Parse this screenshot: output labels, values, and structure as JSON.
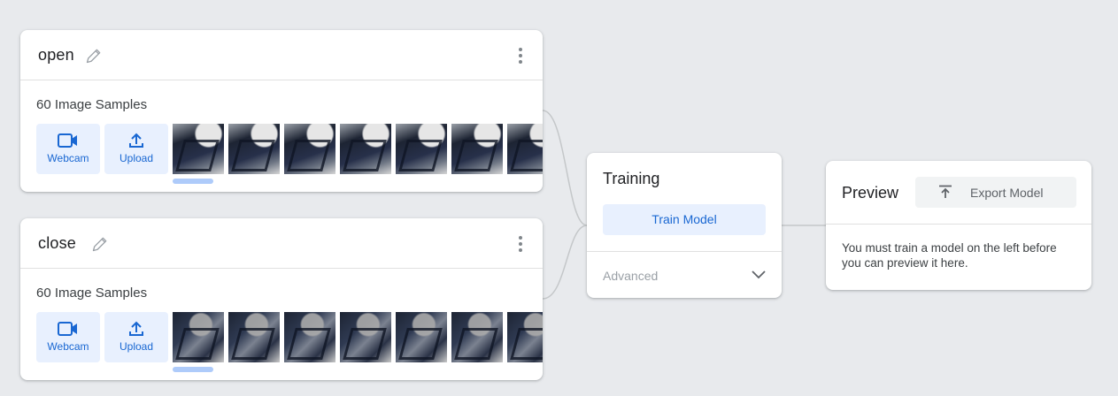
{
  "classes": [
    {
      "name": "open",
      "samples_label": "60 Image Samples",
      "webcam_label": "Webcam",
      "upload_label": "Upload"
    },
    {
      "name": "close",
      "samples_label": "60 Image Samples",
      "webcam_label": "Webcam",
      "upload_label": "Upload"
    }
  ],
  "training": {
    "title": "Training",
    "train_button": "Train Model",
    "advanced_label": "Advanced"
  },
  "preview": {
    "title": "Preview",
    "export_button": "Export Model",
    "message": "You must train a model on the left before you can preview it here."
  },
  "colors": {
    "background": "#e8eaed",
    "accent": "#1967d2",
    "accent_light": "#e8f0fe",
    "scroll_indicator": "#aecbfa"
  },
  "icons": [
    "pencil-icon",
    "more-vert-icon",
    "videocam-icon",
    "upload-icon",
    "chevron-down-icon",
    "export-icon"
  ]
}
